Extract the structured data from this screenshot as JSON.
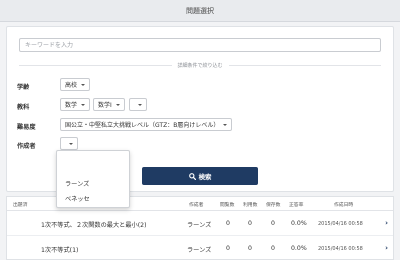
{
  "header": {
    "title": "問題選択"
  },
  "search": {
    "placeholder": "キーワードを入力",
    "value": ""
  },
  "filter_divider": "詳細条件で絞り込む",
  "filters": {
    "grade": {
      "label": "学齢",
      "value": "高校"
    },
    "subject": {
      "label": "教科",
      "values": [
        "数学",
        "数学I",
        ""
      ]
    },
    "difficulty": {
      "label": "難易度",
      "value": "国公立・中堅私立大挑戦レベル（GTZ：B層向けレベル）"
    },
    "author": {
      "label": "作成者",
      "value": "",
      "options": [
        "",
        "ラーンズ",
        "ベネッセ"
      ]
    }
  },
  "search_button": {
    "label": "検索",
    "icon": "search-icon"
  },
  "results": {
    "columns": [
      "出題済",
      "作成者",
      "閲覧数",
      "利用数",
      "保存数",
      "正答率",
      "作成日時"
    ],
    "rows": [
      {
        "title": "1次不等式、２次関数の最大と最小(2)",
        "author": "ラーンズ",
        "views": "0",
        "uses": "0",
        "saves": "0",
        "rate": "0.0%",
        "date": "2015/04/16 00:58"
      },
      {
        "title": "1次不等式(1)",
        "author": "ラーンズ",
        "views": "0",
        "uses": "0",
        "saves": "0",
        "rate": "0.0%",
        "date": "2015/04/16 00:58"
      }
    ]
  },
  "colors": {
    "accent": "#1f3b63",
    "background": "#f2f3f5"
  }
}
